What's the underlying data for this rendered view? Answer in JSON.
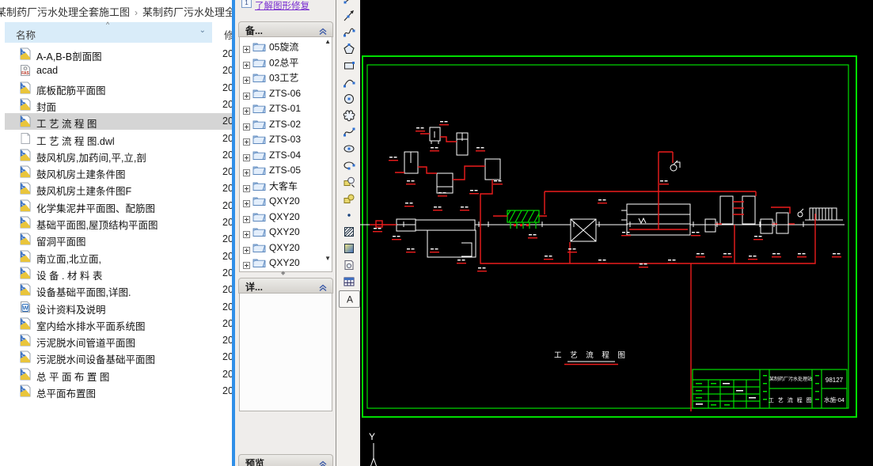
{
  "explorer": {
    "breadcrumb": [
      "某制药厂污水处理全套施工图",
      "某制药厂污水处理全套施"
    ],
    "breadcrumb_separator": "›",
    "columns": {
      "name": "名称",
      "modified": "修改日期"
    },
    "sort_caret": "^",
    "filter_drop": "⌄",
    "date_prefix": "20",
    "files": [
      {
        "name": "A-A,B-B剖面图",
        "icon": "dwg"
      },
      {
        "name": "acad",
        "icon": "fas"
      },
      {
        "name": "底板配筋平面图",
        "icon": "dwg"
      },
      {
        "name": "封面",
        "icon": "dwg"
      },
      {
        "name": "工 艺 流 程 图",
        "icon": "dwg",
        "selected": true
      },
      {
        "name": "工 艺 流 程 图.dwl",
        "icon": "dwl"
      },
      {
        "name": "鼓风机房,加药间,平,立,剖",
        "icon": "dwg"
      },
      {
        "name": "鼓风机房土建条件图",
        "icon": "dwg"
      },
      {
        "name": "鼓风机房土建条件图F",
        "icon": "dwg"
      },
      {
        "name": "化学集泥井平面图、配筋图",
        "icon": "dwg"
      },
      {
        "name": "基础平面图,屋顶结构平面图",
        "icon": "dwg"
      },
      {
        "name": "留洞平面图",
        "icon": "dwg"
      },
      {
        "name": "南立面,北立面,",
        "icon": "dwg"
      },
      {
        "name": "设 备 . 材 料 表",
        "icon": "dwg"
      },
      {
        "name": "设备基础平面图,详图.",
        "icon": "dwg"
      },
      {
        "name": "设计资料及说明",
        "icon": "doc"
      },
      {
        "name": "室内给水排水平面系统图",
        "icon": "dwg"
      },
      {
        "name": "污泥脱水间管道平面图",
        "icon": "dwg"
      },
      {
        "name": "污泥脱水间设备基础平面图",
        "icon": "dwg"
      },
      {
        "name": "总 平 面 布 置 图",
        "icon": "dwg"
      },
      {
        "name": "总平面布置图",
        "icon": "dwg"
      }
    ]
  },
  "palette": {
    "help_badge": "1",
    "help_link": "了解图形修复",
    "sections": {
      "backup": "备...",
      "details": "详...",
      "preview": "预览"
    },
    "tree": [
      "05旋流",
      "02总平",
      "03工艺",
      "ZTS-06",
      "ZTS-01",
      "ZTS-02",
      "ZTS-03",
      "ZTS-04",
      "ZTS-05",
      "大客车",
      "QXY20",
      "QXY20",
      "QXY20",
      "QXY20",
      "QXY20"
    ]
  },
  "toolbar": {
    "tools": [
      "line",
      "construction-line",
      "polyline",
      "polygon",
      "rectangle",
      "arc",
      "circle",
      "revision-cloud",
      "spline",
      "ellipse",
      "ellipse-arc",
      "insert-block",
      "make-block",
      "point",
      "hatch",
      "gradient",
      "region",
      "table",
      "mtext"
    ]
  },
  "cad": {
    "drawing_title": "工 艺 流 程 图",
    "ucs_axis_label": "Y",
    "titleblock": {
      "project": "某制药厂污水处理站",
      "drawing_name": "工 艺 流 程 图",
      "project_no": "98127",
      "sheet_no": "水施-04"
    },
    "colors": {
      "frame_green": "#00dd00",
      "pipe_red": "#ec1c1c",
      "draw_white": "#ffffff"
    }
  }
}
